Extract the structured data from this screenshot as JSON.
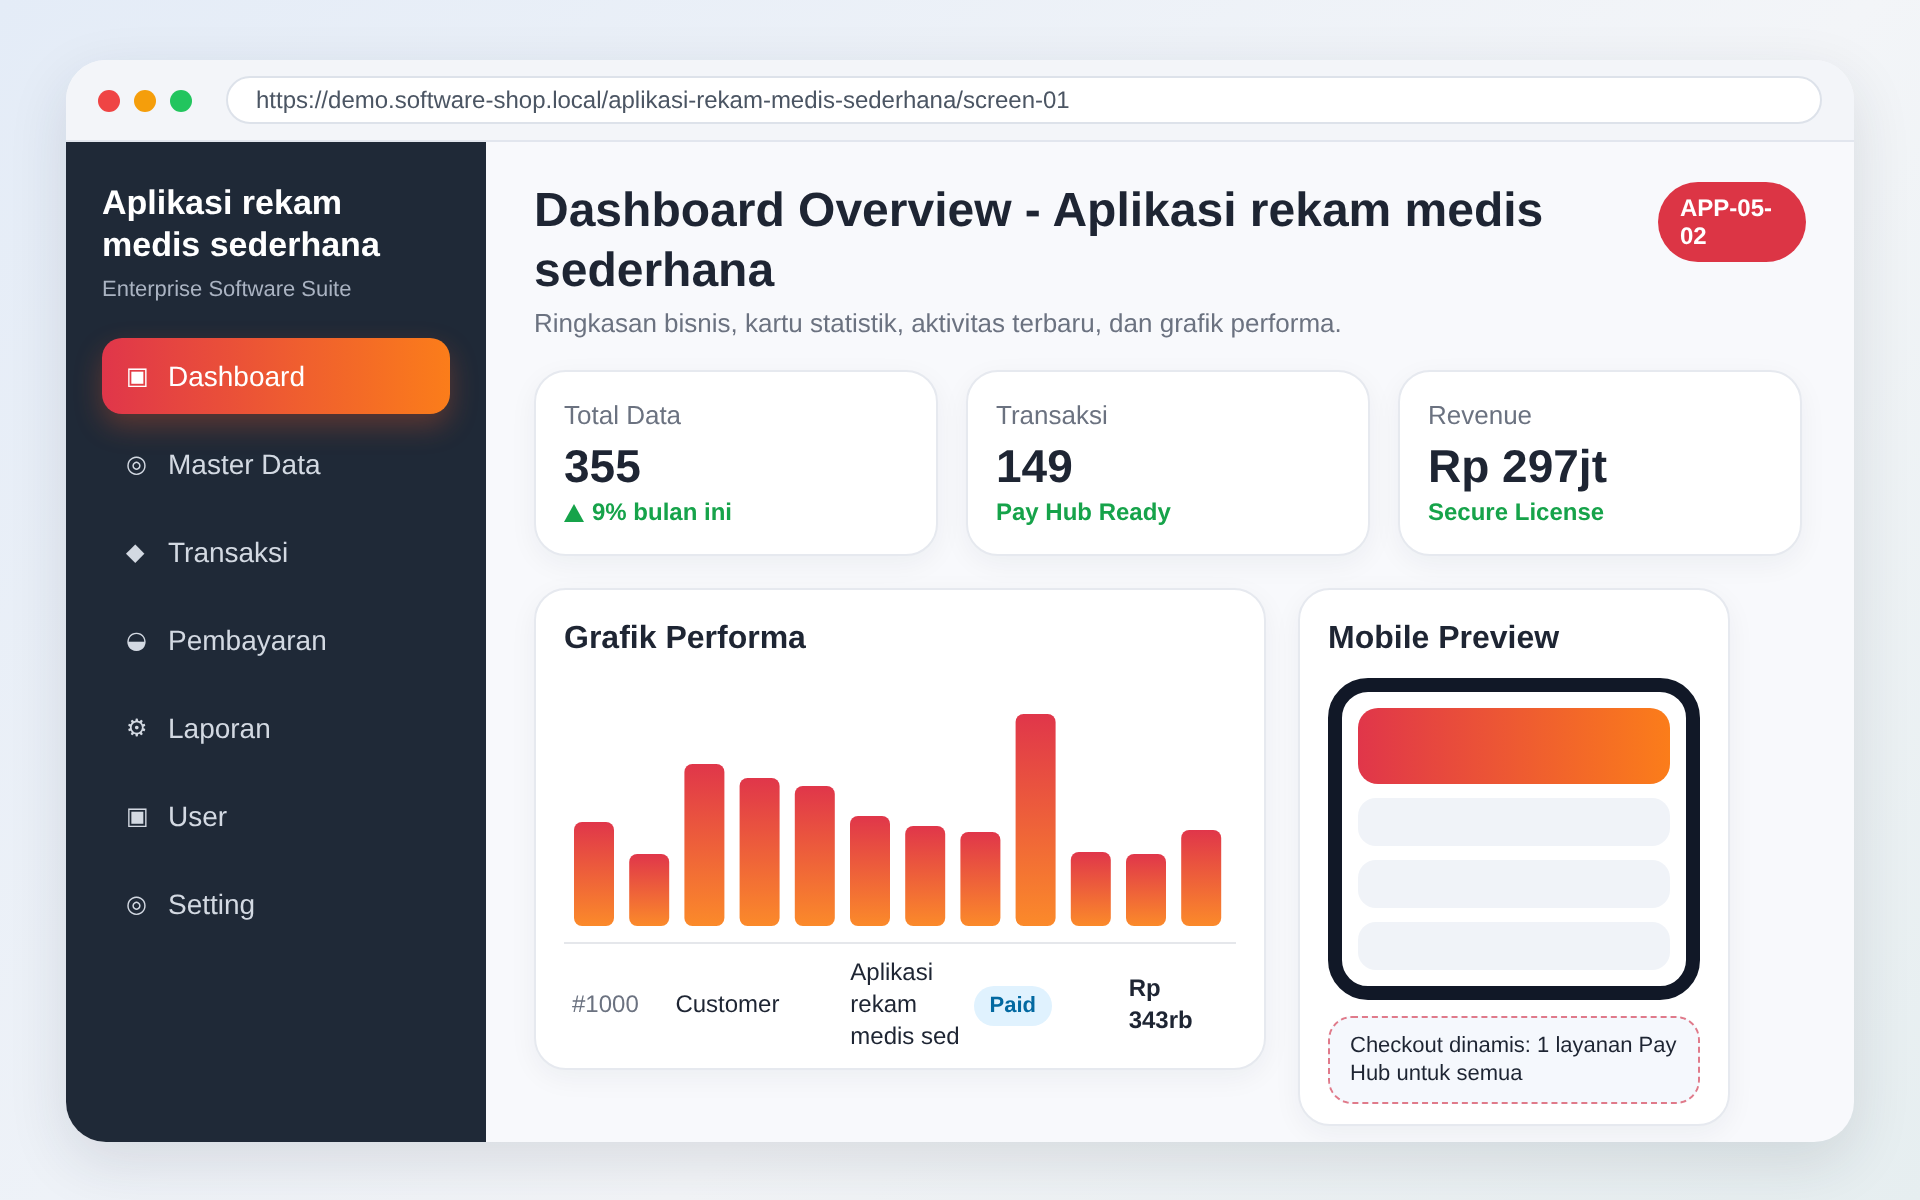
{
  "browser": {
    "url": "https://demo.software-shop.local/aplikasi-rekam-medis-sederhana/screen-01"
  },
  "sidebar": {
    "title": "Aplikasi rekam medis sederhana",
    "subtitle": "Enterprise Software Suite",
    "items": [
      {
        "icon": "▣",
        "label": "Dashboard",
        "selected": true
      },
      {
        "icon": "◎",
        "label": "Master Data",
        "selected": false
      },
      {
        "icon": "◆",
        "label": "Transaksi",
        "selected": false
      },
      {
        "icon": "◒",
        "label": "Pembayaran",
        "selected": false
      },
      {
        "icon": "⚙",
        "label": "Laporan",
        "selected": false
      },
      {
        "icon": "▣",
        "label": "User",
        "selected": false
      },
      {
        "icon": "◎",
        "label": "Setting",
        "selected": false
      }
    ]
  },
  "header": {
    "title": "Dashboard Overview - Aplikasi rekam medis sederhana",
    "subtitle": "Ringkasan bisnis, kartu statistik, aktivitas terbaru, dan grafik performa.",
    "badge": "APP-05-02"
  },
  "stats": [
    {
      "label": "Total Data",
      "value": "355",
      "note": "9% bulan ini",
      "trend_up": true
    },
    {
      "label": "Transaksi",
      "value": "149",
      "note": "Pay Hub Ready",
      "trend_up": false
    },
    {
      "label": "Revenue",
      "value": "Rp 297jt",
      "note": "Secure License",
      "trend_up": false
    }
  ],
  "performance": {
    "title": "Grafik Performa",
    "rows": [
      {
        "id": "#1000",
        "customer": "Customer",
        "product": "Aplikasi rekam medis sed",
        "status": "Paid",
        "amount": "Rp 343rb"
      }
    ]
  },
  "mobile_preview": {
    "title": "Mobile Preview",
    "note": "Checkout dinamis: 1 layanan Pay Hub untuk semua"
  }
}
